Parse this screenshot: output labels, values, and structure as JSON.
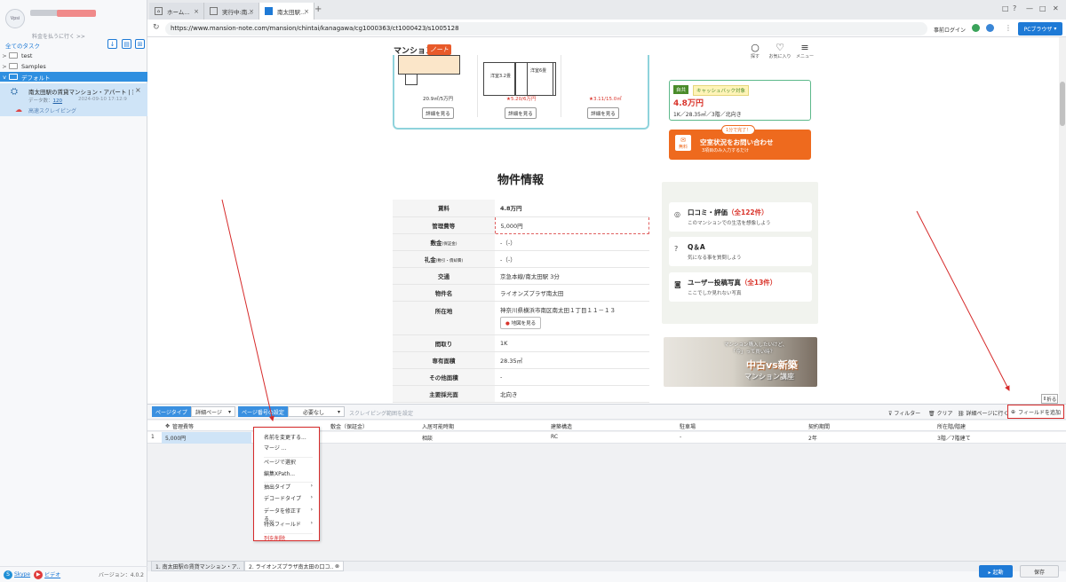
{
  "sidebar": {
    "avatar_text": "Vpsi",
    "promo": "料金を払うに行く >>",
    "all_tasks": "全てのタスク",
    "folders": [
      {
        "arrow": ">",
        "label": "test"
      },
      {
        "arrow": ">",
        "label": "Samples"
      },
      {
        "arrow": "v",
        "label": "デフォルト"
      }
    ],
    "task": {
      "title": "南太田駅の賃貸マンション・アパート | 家...",
      "count_label": "データ数：",
      "count": "120",
      "date": "2024-09-10 17:12:9",
      "cloud_label": "高速スクレイピング"
    },
    "footer": {
      "skype": "Skype",
      "video": "ビデオ",
      "version": "バージョン：4.0.2"
    }
  },
  "browser": {
    "tabs": [
      "ホーム...",
      "実行中:南...",
      "南太田駅..."
    ],
    "new_tab": "+",
    "window_buttons": [
      "□",
      "?",
      "—",
      "□",
      "✕"
    ],
    "url": "https://www.mansion-note.com/mansion/chintai/kanagawa/cg1000363/ct1000423/s1005128",
    "login": "事前ログイン",
    "pc_browser": "PCブラウザ"
  },
  "site": {
    "logo": "マンション",
    "logo_badge": "ノート",
    "nav": [
      {
        "icon": "○",
        "label": "探す"
      },
      {
        "icon": "♡",
        "label": "お気に入り"
      },
      {
        "icon": "≡",
        "label": "メニュー"
      }
    ],
    "plans": [
      {
        "price": "20.9㎡/5万円",
        "room": ""
      },
      {
        "price": "5.20/6万円",
        "room": "洋室3.2畳"
      },
      {
        "price": "3.11/15.0㎡",
        "room": "洋室6畳"
      }
    ],
    "plan_room_left": "",
    "plan_detail": "詳細を見る",
    "section_title": "物件情報",
    "details": [
      {
        "k": "賃料",
        "v": "4.8万円"
      },
      {
        "k": "管理費等",
        "v": "5,000円"
      },
      {
        "k": "敷金",
        "sub": "(保証金)",
        "v": "-（-）"
      },
      {
        "k": "礼金",
        "sub": "(敷引・償却費)",
        "v": "-（-）"
      },
      {
        "k": "交通",
        "v": "京急本線/南太田駅 3分"
      },
      {
        "k": "物件名",
        "v": "ライオンズプラザ南太田"
      },
      {
        "k": "所在地",
        "v": "神奈川県横浜市南区南太田１丁目１１－１３"
      },
      {
        "k": "間取り",
        "v": "1K"
      },
      {
        "k": "専有面積",
        "v": "28.35㎡"
      },
      {
        "k": "その他面積",
        "v": "-"
      },
      {
        "k": "主要採光面",
        "v": "北向き"
      }
    ],
    "map_button": "地図を見る",
    "rent_badge1": "自共",
    "rent_badge2": "キャッシュバック対象",
    "rent_price": "4.8万円",
    "rent_spec": "1K／28.35㎡／3階／北向き",
    "cta_tag": "1分で完了！",
    "cta_icon": "無料",
    "cta_main": "空室状況をお問い合わせ",
    "cta_sub": "3項目のみ入力するだけ",
    "reviews": [
      {
        "icon": "◎",
        "title": "口コミ・評価",
        "count": "（全122件）",
        "sub": "このマンションでの生活を想像しよう"
      },
      {
        "icon": "?",
        "title": "Q＆A",
        "count": "",
        "sub": "気になる事を質問しよう"
      },
      {
        "icon": "◙",
        "title": "ユーザー投稿写真",
        "count": "（全13件）",
        "sub": "ここでしか見れない写真"
      }
    ],
    "banner_line1": "マンション購入したいけど、",
    "banner_line1b": "「今」って買い時？",
    "banner_main": "中古vs新築",
    "banner_sub": "マンション講座"
  },
  "workspace": {
    "fold": "折る",
    "page_type_label": "ページタイプ",
    "page_type_value": "詳細ページ",
    "page_setting_label": "ページ番号の設定",
    "page_setting_value": "必要なし",
    "scrape_range": "スクレイピング範囲を設定",
    "filter": "フィルター",
    "clear": "クリア",
    "detail_link": "詳細ページに行く",
    "add_field": "フィールドを追加",
    "columns": [
      "管理費等",
      "敷金（保証金）",
      "入居可能時期",
      "建築構造",
      "駐車場",
      "契約期間",
      "所在階/階建"
    ],
    "row": {
      "index": "1",
      "values": [
        "5,000円",
        "",
        "相談",
        "RC",
        "-",
        "2年",
        "3階／7階建て"
      ]
    },
    "menu": [
      "名前を変更する...",
      "マージ ...",
      "ページで選択",
      "編集XPath...",
      "抽出タイプ",
      "デコードタイプ",
      "データを修正する...",
      "特殊フィールド",
      "列を削除"
    ],
    "menu_arrows": [
      false,
      false,
      false,
      false,
      true,
      true,
      true,
      true,
      false
    ],
    "bottom_tabs": [
      "1. 南太田駅の賃貸マンション・ア...",
      "2. ライオンズプラザ南太田の口コ..."
    ],
    "run": "▸ 起動",
    "save": "保存"
  }
}
